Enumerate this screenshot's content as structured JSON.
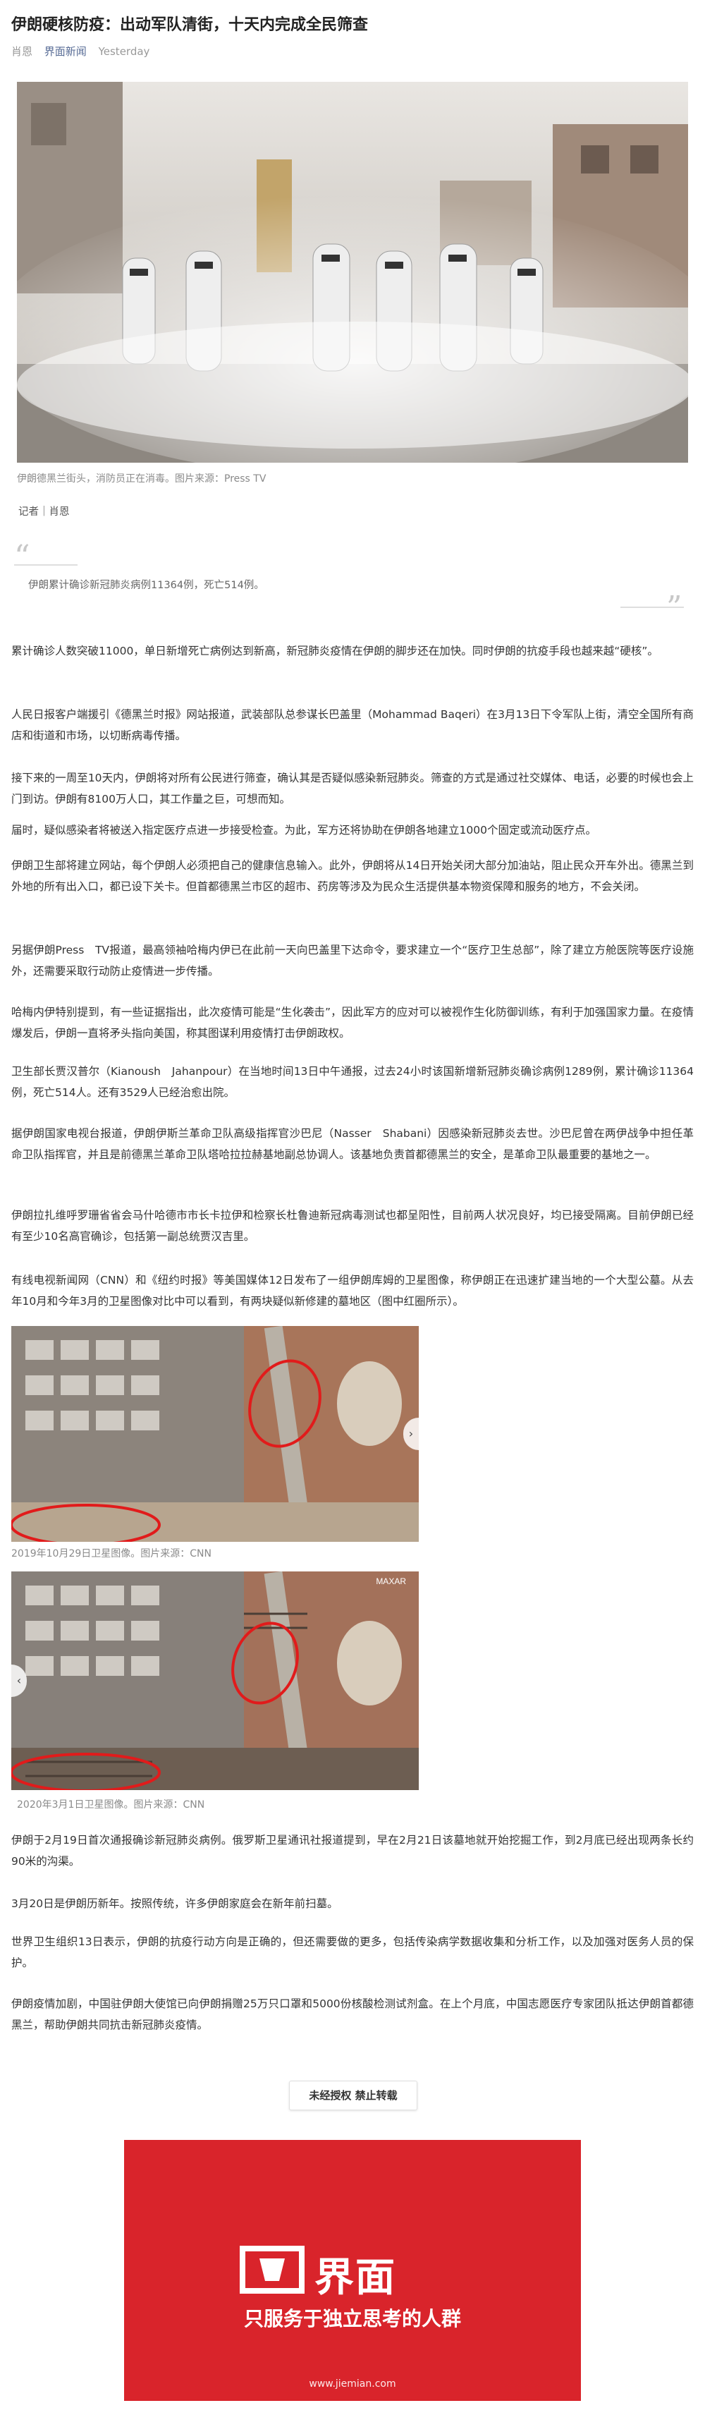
{
  "article": {
    "title": "伊朗硬核防疫：出动军队清街，十天内完成全民筛查",
    "author": "肖恩",
    "source": "界面新闻",
    "time": "Yesterday"
  },
  "hero_caption": "伊朗德黑兰街头，消防员正在消毒。图片来源：Press TV",
  "reporter": "记者｜肖恩",
  "quote": "伊朗累计确诊新冠肺炎病例11364例，死亡514例。",
  "paragraphs": [
    "累计确诊人数突破11000，单日新增死亡病例达到新高，新冠肺炎疫情在伊朗的脚步还在加快。同时伊朗的抗疫手段也越来越“硬核”。",
    "人民日报客户端援引《德黑兰时报》网站报道，武装部队总参谋长巴盖里（Mohammad Baqeri）在3月13日下令军队上街，清空全国所有商店和街道和市场，以切断病毒传播。",
    "接下来的一周至10天内，伊朗将对所有公民进行筛查，确认其是否疑似感染新冠肺炎。筛查的方式是通过社交媒体、电话，必要的时候也会上门到访。伊朗有8100万人口，其工作量之巨，可想而知。",
    "届时，疑似感染者将被送入指定医疗点进一步接受检查。为此，军方还将协助在伊朗各地建立1000个固定或流动医疗点。",
    "伊朗卫生部将建立网站，每个伊朗人必须把自己的健康信息输入。此外，伊朗将从14日开始关闭大部分加油站，阻止民众开车外出。德黑兰到外地的所有出入口，都已设下关卡。但首都德黑兰市区的超市、药房等涉及为民众生活提供基本物资保障和服务的地方，不会关闭。",
    "另据伊朗Press　TV报道，最高领袖哈梅内伊已在此前一天向巴盖里下达命令，要求建立一个“医疗卫生总部”，除了建立方舱医院等医疗设施外，还需要采取行动防止疫情进一步传播。",
    "哈梅内伊特别提到，有一些证据指出，此次疫情可能是“生化袭击”，因此军方的应对可以被视作生化防御训练，有利于加强国家力量。在疫情爆发后，伊朗一直将矛头指向美国，称其图谋利用疫情打击伊朗政权。",
    "卫生部长贾汉普尔（Kianoush　Jahanpour）在当地时间13日中午通报，过去24小时该国新增新冠肺炎确诊病例1289例，累计确诊11364例，死亡514人。还有3529人已经治愈出院。",
    "据伊朗国家电视台报道，伊朗伊斯兰革命卫队高级指挥官沙巴尼（Nasser　Shabani）因感染新冠肺炎去世。沙巴尼曾在两伊战争中担任革命卫队指挥官，并且是前德黑兰革命卫队塔哈拉拉赫基地副总协调人。该基地负责首都德黑兰的安全，是革命卫队最重要的基地之一。",
    "伊朗拉扎维呼罗珊省省会马什哈德市市长卡拉伊和检察长杜鲁迪新冠病毒测试也都呈阳性，目前两人状况良好，均已接受隔离。目前伊朗已经有至少10名高官确诊，包括第一副总统贾汉吉里。",
    "有线电视新闻网（CNN）和《纽约时报》等美国媒体12日发布了一组伊朗库姆的卫星图像，称伊朗正在迅速扩建当地的一个大型公墓。从去年10月和今年3月的卫星图像对比中可以看到，有两块疑似新修建的墓地区（图中红圈所示）。",
    "伊朗于2月19日首次通报确诊新冠肺炎病例。俄罗斯卫星通讯社报道提到，早在2月21日该墓地就开始挖掘工作，到2月底已经出现两条长约90米的沟渠。",
    "3月20日是伊朗历新年。按照传统，许多伊朗家庭会在新年前扫墓。",
    "世界卫生组织13日表示，伊朗的抗疫行动方向是正确的，但还需要做的更多，包括传染病学数据收集和分析工作，以及加强对医务人员的保护。",
    "伊朗疫情加剧，中国驻伊朗大使馆已向伊朗捐赠25万只口罩和5000份核酸检测试剂盒。在上个月底，中国志愿医疗专家团队抵达伊朗首都德黑兰，帮助伊朗共同抗击新冠肺炎疫情。"
  ],
  "sat1_caption": "2019年10月29日卫星图像。图片来源：CNN",
  "sat2_caption": "2020年3月1日卫星图像。图片来源：CNN",
  "watermark": "MAXAR",
  "notice": "未经授权 禁止转载",
  "promo": {
    "brand": "界面",
    "slogan": "只服务于独立思考的人群",
    "url": "www.jiemian.com"
  }
}
